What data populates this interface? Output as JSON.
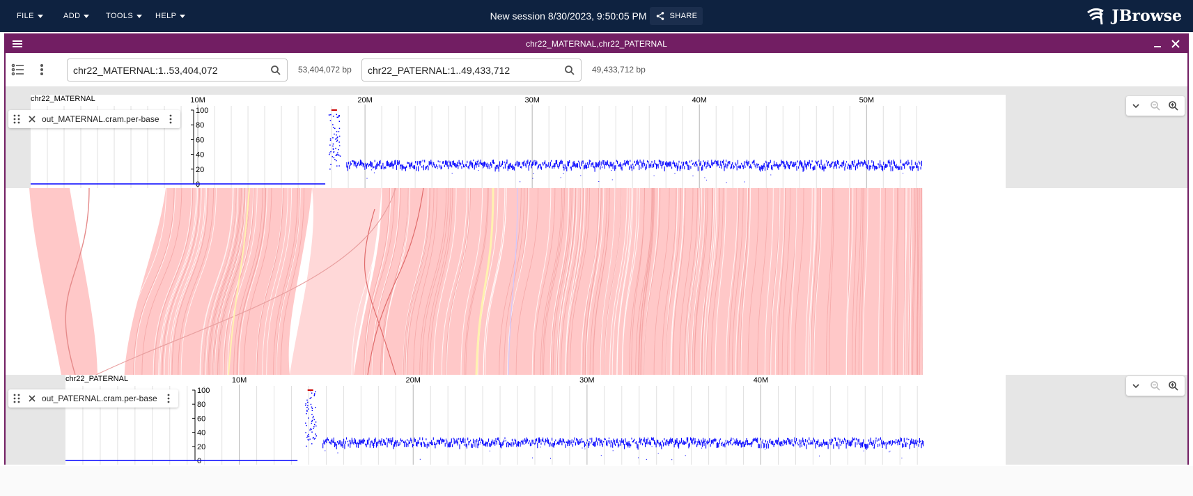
{
  "appbar": {
    "menus": [
      "FILE",
      "ADD",
      "TOOLS",
      "HELP"
    ],
    "session_title": "New session 8/30/2023, 9:50:05 PM",
    "share_label": "SHARE",
    "logo_text": "JBrowse",
    "bg_color": "#0e2240"
  },
  "view": {
    "title": "chr22_MATERNAL,chr22_PATERNAL",
    "header_color": "#721e63",
    "top_locator": {
      "value": "chr22_MATERNAL:1..53,404,072",
      "bp": "53,404,072 bp"
    },
    "bottom_locator": {
      "value": "chr22_PATERNAL:1..49,433,712",
      "bp": "49,433,712 bp"
    }
  },
  "top_panel": {
    "ref_name": "chr22_MATERNAL",
    "ticks": [
      "10M",
      "20M",
      "30M",
      "40M",
      "50M"
    ],
    "tick_values": [
      10,
      20,
      30,
      40,
      50
    ],
    "length_mb": 53.404072,
    "track_label": "out_MATERNAL.cram.per-base",
    "y_ticks": [
      "100",
      "80",
      "60",
      "40",
      "20",
      "0"
    ]
  },
  "bottom_panel": {
    "ref_name": "chr22_PATERNAL",
    "ticks": [
      "10M",
      "20M",
      "30M",
      "40M"
    ],
    "tick_values": [
      10,
      20,
      30,
      40
    ],
    "length_mb": 49.433712,
    "track_label": "out_PATERNAL.cram.per-base",
    "y_ticks": [
      "100",
      "80",
      "60",
      "40",
      "20",
      "0"
    ]
  },
  "colors": {
    "synteny": "#ffc8c8",
    "coverage": "#0000ff",
    "clip": "#cc0000"
  }
}
